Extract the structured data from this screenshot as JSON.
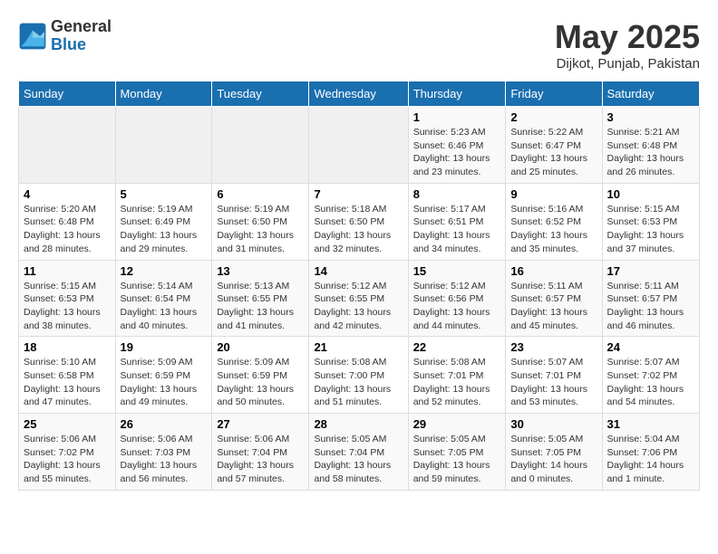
{
  "header": {
    "logo_general": "General",
    "logo_blue": "Blue",
    "month_title": "May 2025",
    "location": "Dijkot, Punjab, Pakistan"
  },
  "weekdays": [
    "Sunday",
    "Monday",
    "Tuesday",
    "Wednesday",
    "Thursday",
    "Friday",
    "Saturday"
  ],
  "weeks": [
    [
      {
        "day": "",
        "info": ""
      },
      {
        "day": "",
        "info": ""
      },
      {
        "day": "",
        "info": ""
      },
      {
        "day": "",
        "info": ""
      },
      {
        "day": "1",
        "info": "Sunrise: 5:23 AM\nSunset: 6:46 PM\nDaylight: 13 hours\nand 23 minutes."
      },
      {
        "day": "2",
        "info": "Sunrise: 5:22 AM\nSunset: 6:47 PM\nDaylight: 13 hours\nand 25 minutes."
      },
      {
        "day": "3",
        "info": "Sunrise: 5:21 AM\nSunset: 6:48 PM\nDaylight: 13 hours\nand 26 minutes."
      }
    ],
    [
      {
        "day": "4",
        "info": "Sunrise: 5:20 AM\nSunset: 6:48 PM\nDaylight: 13 hours\nand 28 minutes."
      },
      {
        "day": "5",
        "info": "Sunrise: 5:19 AM\nSunset: 6:49 PM\nDaylight: 13 hours\nand 29 minutes."
      },
      {
        "day": "6",
        "info": "Sunrise: 5:19 AM\nSunset: 6:50 PM\nDaylight: 13 hours\nand 31 minutes."
      },
      {
        "day": "7",
        "info": "Sunrise: 5:18 AM\nSunset: 6:50 PM\nDaylight: 13 hours\nand 32 minutes."
      },
      {
        "day": "8",
        "info": "Sunrise: 5:17 AM\nSunset: 6:51 PM\nDaylight: 13 hours\nand 34 minutes."
      },
      {
        "day": "9",
        "info": "Sunrise: 5:16 AM\nSunset: 6:52 PM\nDaylight: 13 hours\nand 35 minutes."
      },
      {
        "day": "10",
        "info": "Sunrise: 5:15 AM\nSunset: 6:53 PM\nDaylight: 13 hours\nand 37 minutes."
      }
    ],
    [
      {
        "day": "11",
        "info": "Sunrise: 5:15 AM\nSunset: 6:53 PM\nDaylight: 13 hours\nand 38 minutes."
      },
      {
        "day": "12",
        "info": "Sunrise: 5:14 AM\nSunset: 6:54 PM\nDaylight: 13 hours\nand 40 minutes."
      },
      {
        "day": "13",
        "info": "Sunrise: 5:13 AM\nSunset: 6:55 PM\nDaylight: 13 hours\nand 41 minutes."
      },
      {
        "day": "14",
        "info": "Sunrise: 5:12 AM\nSunset: 6:55 PM\nDaylight: 13 hours\nand 42 minutes."
      },
      {
        "day": "15",
        "info": "Sunrise: 5:12 AM\nSunset: 6:56 PM\nDaylight: 13 hours\nand 44 minutes."
      },
      {
        "day": "16",
        "info": "Sunrise: 5:11 AM\nSunset: 6:57 PM\nDaylight: 13 hours\nand 45 minutes."
      },
      {
        "day": "17",
        "info": "Sunrise: 5:11 AM\nSunset: 6:57 PM\nDaylight: 13 hours\nand 46 minutes."
      }
    ],
    [
      {
        "day": "18",
        "info": "Sunrise: 5:10 AM\nSunset: 6:58 PM\nDaylight: 13 hours\nand 47 minutes."
      },
      {
        "day": "19",
        "info": "Sunrise: 5:09 AM\nSunset: 6:59 PM\nDaylight: 13 hours\nand 49 minutes."
      },
      {
        "day": "20",
        "info": "Sunrise: 5:09 AM\nSunset: 6:59 PM\nDaylight: 13 hours\nand 50 minutes."
      },
      {
        "day": "21",
        "info": "Sunrise: 5:08 AM\nSunset: 7:00 PM\nDaylight: 13 hours\nand 51 minutes."
      },
      {
        "day": "22",
        "info": "Sunrise: 5:08 AM\nSunset: 7:01 PM\nDaylight: 13 hours\nand 52 minutes."
      },
      {
        "day": "23",
        "info": "Sunrise: 5:07 AM\nSunset: 7:01 PM\nDaylight: 13 hours\nand 53 minutes."
      },
      {
        "day": "24",
        "info": "Sunrise: 5:07 AM\nSunset: 7:02 PM\nDaylight: 13 hours\nand 54 minutes."
      }
    ],
    [
      {
        "day": "25",
        "info": "Sunrise: 5:06 AM\nSunset: 7:02 PM\nDaylight: 13 hours\nand 55 minutes."
      },
      {
        "day": "26",
        "info": "Sunrise: 5:06 AM\nSunset: 7:03 PM\nDaylight: 13 hours\nand 56 minutes."
      },
      {
        "day": "27",
        "info": "Sunrise: 5:06 AM\nSunset: 7:04 PM\nDaylight: 13 hours\nand 57 minutes."
      },
      {
        "day": "28",
        "info": "Sunrise: 5:05 AM\nSunset: 7:04 PM\nDaylight: 13 hours\nand 58 minutes."
      },
      {
        "day": "29",
        "info": "Sunrise: 5:05 AM\nSunset: 7:05 PM\nDaylight: 13 hours\nand 59 minutes."
      },
      {
        "day": "30",
        "info": "Sunrise: 5:05 AM\nSunset: 7:05 PM\nDaylight: 14 hours\nand 0 minutes."
      },
      {
        "day": "31",
        "info": "Sunrise: 5:04 AM\nSunset: 7:06 PM\nDaylight: 14 hours\nand 1 minute."
      }
    ]
  ]
}
